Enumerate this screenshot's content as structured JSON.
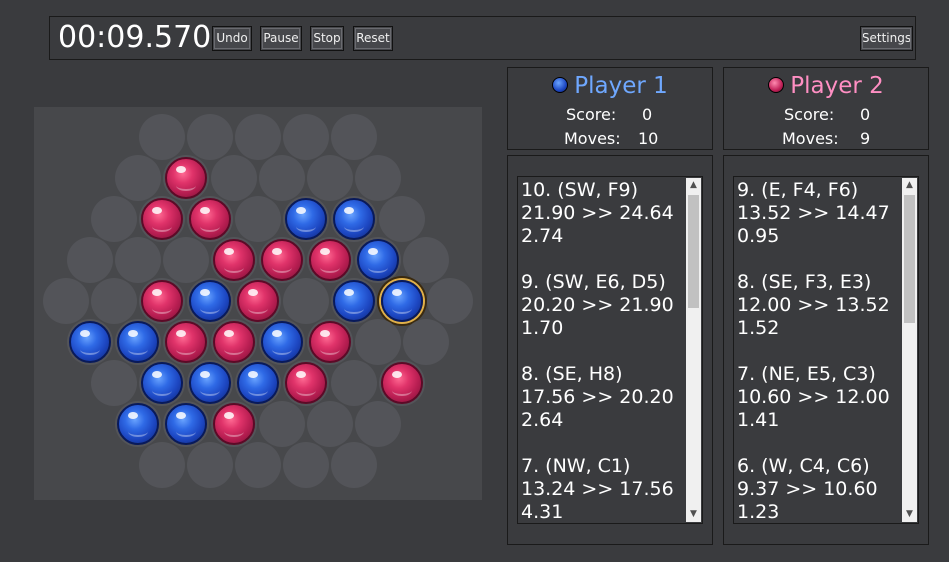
{
  "toolbar": {
    "timer": "00:09.570",
    "undo_label": "Undo",
    "pause_label": "Pause",
    "stop_label": "Stop",
    "reset_label": "Reset",
    "settings_label": "Settings"
  },
  "colors": {
    "player1": "#6fa8ff",
    "player2": "#ff8fc3",
    "red_marble": "#d42a5f",
    "blue_marble": "#2a5fe0",
    "board": "#47484b",
    "cell": "#535459",
    "selection_ring": "#e0b04a"
  },
  "board": {
    "rows": [
      [
        "empty",
        "empty",
        "empty",
        "empty",
        "empty"
      ],
      [
        "empty",
        "red",
        "empty",
        "empty",
        "empty",
        "empty"
      ],
      [
        "empty",
        "red",
        "red",
        "empty",
        "blue",
        "blue",
        "empty"
      ],
      [
        "empty",
        "empty",
        "empty",
        "red",
        "red",
        "red",
        "blue",
        "empty"
      ],
      [
        "empty",
        "empty",
        "red",
        "blue",
        "red",
        "empty",
        "blue",
        "blue",
        "empty"
      ],
      [
        "blue",
        "blue",
        "red",
        "red",
        "blue",
        "red",
        "empty",
        "empty"
      ],
      [
        "empty",
        "blue",
        "blue",
        "blue",
        "red",
        "empty",
        "red"
      ],
      [
        "blue",
        "blue",
        "red",
        "empty",
        "empty",
        "empty"
      ],
      [
        "empty",
        "empty",
        "empty",
        "empty",
        "empty"
      ]
    ],
    "selected": [
      4,
      7
    ]
  },
  "player1": {
    "name": "Player 1",
    "score_label": "Score:",
    "score": "0",
    "moves_label": "Moves:",
    "moves": "10",
    "log": "10. (SW, F9)\n21.90 >> 24.64\n2.74\n\n9. (SW, E6, D5)\n20.20 >> 21.90\n1.70\n\n8. (SE, H8)\n17.56 >> 20.20\n2.64\n\n7. (NW, C1)\n13.24 >> 17.56\n4.31",
    "scroll_fraction": 0.0
  },
  "player2": {
    "name": "Player 2",
    "score_label": "Score:",
    "score": "0",
    "moves_label": "Moves:",
    "moves": "9",
    "log": "9. (E, F4, F6)\n13.52 >> 14.47\n0.95\n\n8. (SE, F3, E3)\n12.00 >> 13.52\n1.52\n\n7. (NE, E5, C3)\n10.60 >> 12.00\n1.41\n\n6. (W, C4, C6)\n9.37 >> 10.60\n1.23",
    "scroll_fraction": 0.0
  },
  "icons": {
    "scroll_up": "▲",
    "scroll_down": "▼"
  }
}
